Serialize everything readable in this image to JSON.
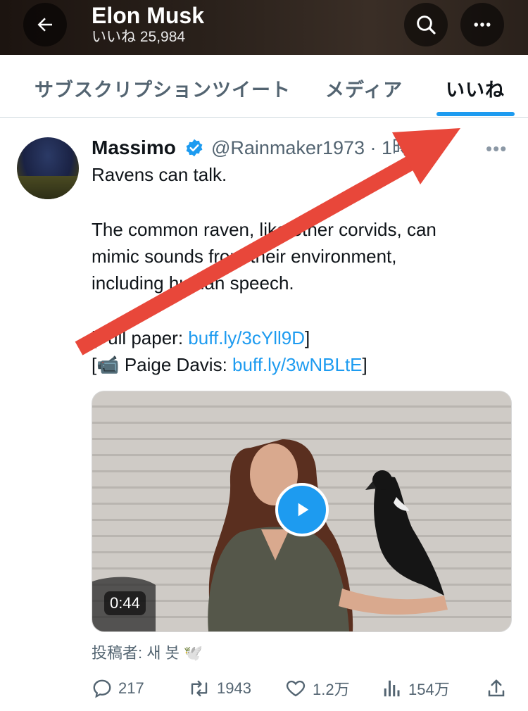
{
  "header": {
    "title": "Elon Musk",
    "subtitle": "いいね 25,984",
    "back_icon": "arrow-left-icon",
    "search_icon": "search-icon",
    "more_icon": "more-dots-icon"
  },
  "tabs": [
    {
      "label": "サブスクリプションツイート",
      "selected": false
    },
    {
      "label": "メディア",
      "selected": false
    },
    {
      "label": "いいね",
      "selected": true
    }
  ],
  "tweet": {
    "name": "Massimo",
    "handle": "@Rainmaker1973 · 1時間",
    "lines": [
      "Ravens can talk.",
      "The common raven, like other corvids, can",
      "mimic sounds from their environment,",
      "including human speech."
    ],
    "paper_prefix": "[Full paper: ",
    "paper_link": "buff.ly/3cYll9D",
    "paper_suffix": "]",
    "video_prefix": "[",
    "video_emoji": "📹",
    "video_name": " Paige Davis: ",
    "video_link": "buff.ly/3wNBLtE",
    "video_suffix": "]",
    "media_duration": "0:44",
    "byline": "投稿者: 새 봇 🕊️"
  },
  "actions": {
    "replies": "217",
    "retweets": "1943",
    "likes": "1.2万",
    "views": "154万"
  },
  "colors": {
    "accent": "#1d9bf0",
    "annotation_arrow": "#e8473a"
  }
}
